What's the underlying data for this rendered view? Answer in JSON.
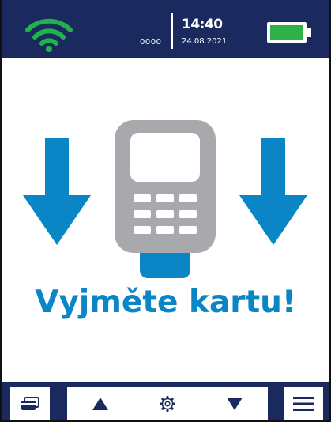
{
  "status_bar": {
    "terminal_id": "0000",
    "time": "14:40",
    "date": "24.08.2021",
    "wifi_icon": "wifi-icon",
    "battery_icon": "battery-icon"
  },
  "main": {
    "message": "Vyjměte kartu!",
    "icons": [
      "arrow-down-icon",
      "card-terminal-icon",
      "arrow-down-icon"
    ]
  },
  "bottom_bar": {
    "buttons": [
      "card-icon",
      "arrow-up-icon",
      "gear-icon",
      "arrow-down-icon",
      "menu-icon"
    ]
  },
  "colors": {
    "header": "#1b2a5e",
    "accent_blue": "#0a86c6",
    "wifi_green": "#22b24c",
    "battery_green": "#2fb24a",
    "terminal_gray": "#a7a9ac"
  }
}
